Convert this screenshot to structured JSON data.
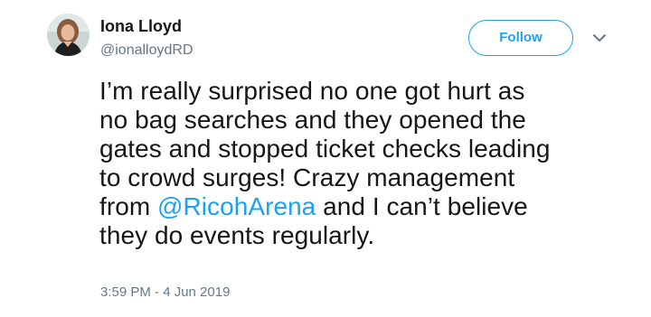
{
  "author": {
    "name": "Iona Lloyd",
    "handle": "@ionalloydRD"
  },
  "actions": {
    "follow_label": "Follow"
  },
  "tweet": {
    "line1": "I’m really surprised no one got hurt as",
    "line2": "no bag searches and they opened the",
    "line3": "gates and stopped ticket checks leading",
    "line4": "to crowd surges! Crazy management",
    "line5_before": "from ",
    "mention": "@RicohArena",
    "line5_after": " and I can’t believe",
    "line6": "they do events regularly."
  },
  "timestamp": "3:59 PM - 4 Jun 2019",
  "colors": {
    "accent": "#1da1f2",
    "secondary_text": "#657786",
    "primary_text": "#14171a"
  },
  "icons": {
    "more": "chevron-down-icon"
  }
}
